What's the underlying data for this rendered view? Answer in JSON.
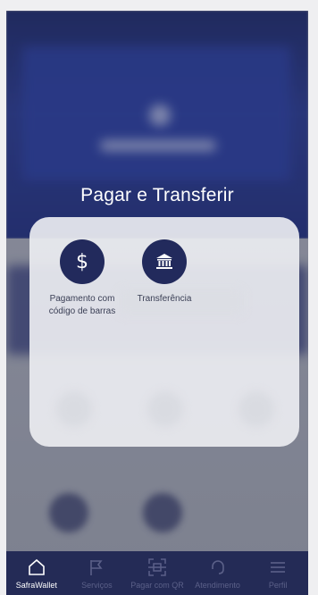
{
  "overlay": {
    "title": "Pagar e Transferir"
  },
  "actions": [
    {
      "label": "Pagamento com código de barras",
      "icon": "dollar-icon"
    },
    {
      "label": "Transferência",
      "icon": "bank-icon"
    }
  ],
  "tabbar": {
    "items": [
      {
        "label": "SafraWallet",
        "icon": "home-icon",
        "active": true
      },
      {
        "label": "Serviços",
        "icon": "flag-icon",
        "active": false
      },
      {
        "label": "Pagar com QR",
        "icon": "qr-scan-icon",
        "active": false
      },
      {
        "label": "Atendimento",
        "icon": "headset-icon",
        "active": false
      },
      {
        "label": "Perfil",
        "icon": "menu-icon",
        "active": false
      }
    ]
  },
  "colors": {
    "accent": "#222a5c",
    "tabbar": "#242b56",
    "panel": "#ecedf1",
    "title": "#ffffff"
  }
}
